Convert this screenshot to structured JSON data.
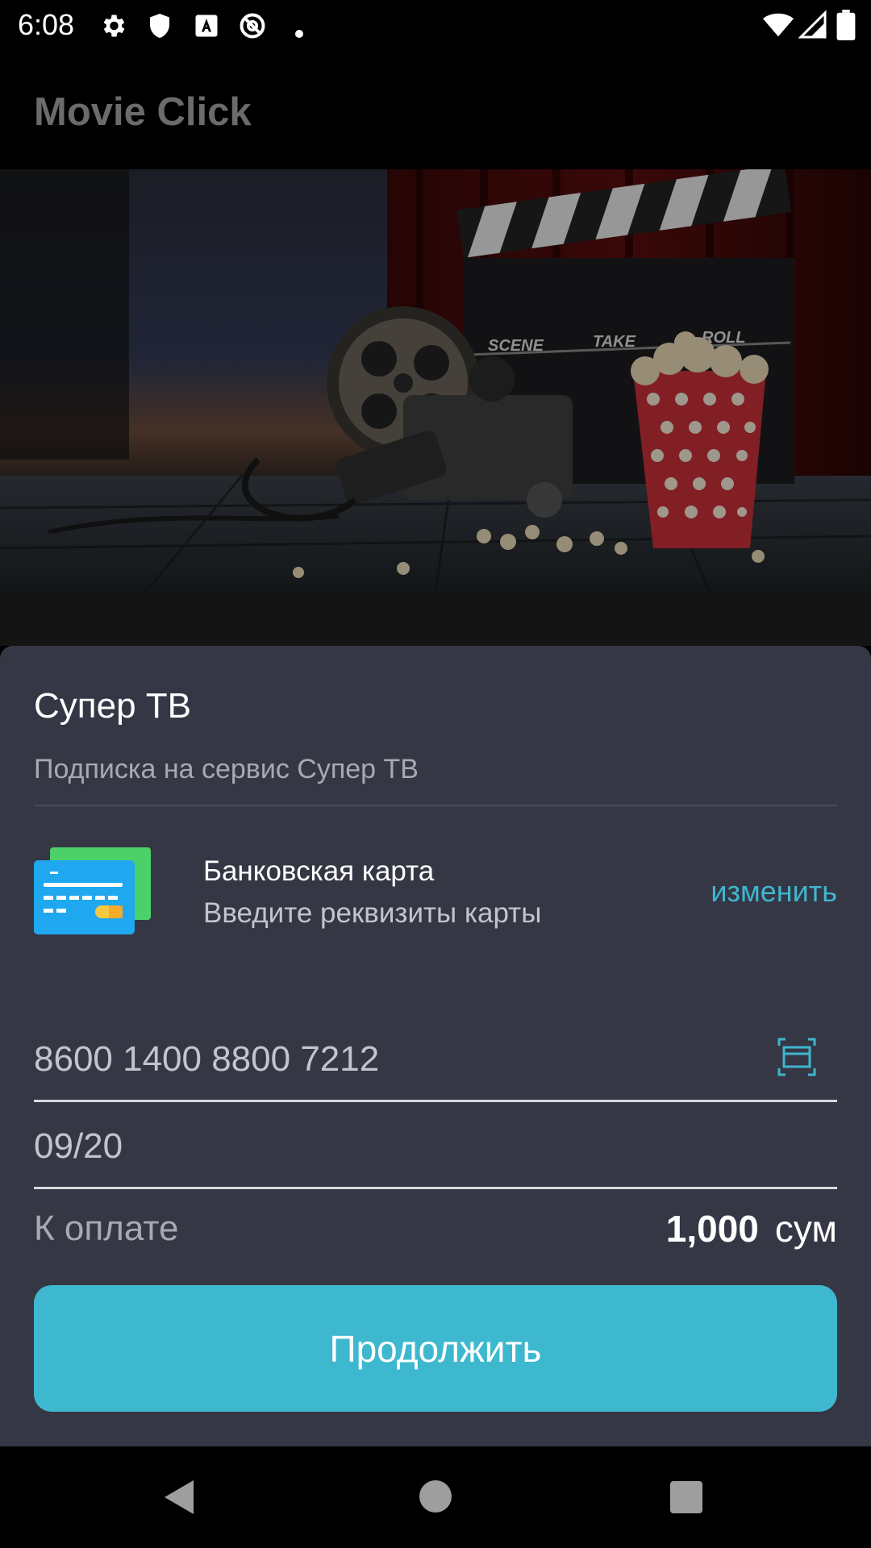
{
  "status_bar": {
    "time": "6:08",
    "icons_left": [
      "gear-icon",
      "shield-icon",
      "text-a-icon",
      "at-sign-icon",
      "dot-icon"
    ],
    "icons_right": [
      "wifi-icon",
      "signal-icon",
      "battery-icon"
    ]
  },
  "app_bar": {
    "title": "Movie Click"
  },
  "hero": {
    "image": "cinema-clapperboard-popcorn-illustration"
  },
  "sheet": {
    "title": "Супер ТВ",
    "subtitle": "Подписка на сервис Супер ТВ",
    "payment_method": {
      "icon": "bank-card-icon",
      "title": "Банковская карта",
      "subtitle": "Введите реквизиты карты",
      "change_label": "изменить"
    },
    "card_number": {
      "value": "8600 1400 8800 7212",
      "icon": "card-scan-icon"
    },
    "expiry": {
      "value": "09/20"
    },
    "total": {
      "label": "К оплате",
      "amount": "1,000",
      "currency": "сум"
    },
    "continue_label": "Продолжить"
  },
  "colors": {
    "sheet_bg": "#363745",
    "accent": "#3db8cf",
    "card_blue": "#1fa8f0",
    "card_green": "#4cd06a"
  },
  "nav_bar": {
    "buttons": [
      "back-icon",
      "home-icon",
      "recents-icon"
    ]
  }
}
